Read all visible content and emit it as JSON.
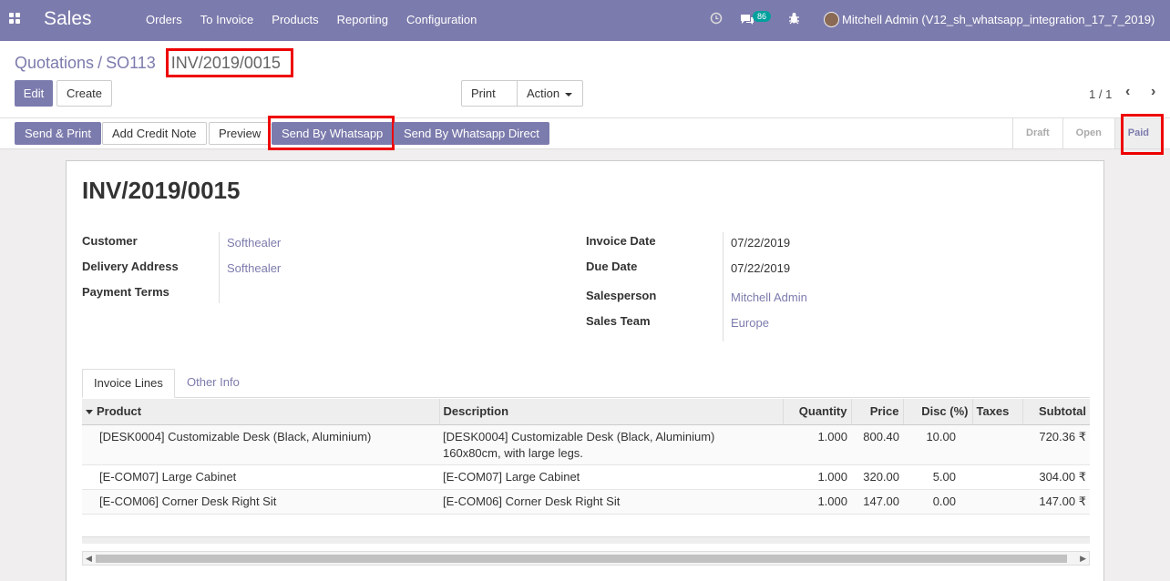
{
  "topbar": {
    "brand": "Sales",
    "menu": [
      "Orders",
      "To Invoice",
      "Products",
      "Reporting",
      "Configuration"
    ],
    "clock_icon": "clock-icon",
    "chat_icon": "chat-icon",
    "chat_count": "86",
    "bug_icon": "bug-icon",
    "user": "Mitchell Admin (V12_sh_whatsapp_integration_17_7_2019)"
  },
  "breadcrumb": {
    "first": "Quotations",
    "sep": "/",
    "second": "SO113",
    "current": "INV/2019/0015"
  },
  "buttons": {
    "edit": "Edit",
    "create": "Create",
    "print": "Print",
    "action": "Action"
  },
  "pager": {
    "value": "1 / 1",
    "prev": "‹",
    "next": "›"
  },
  "statusbar": {
    "send_print": "Send & Print",
    "add_credit_note": "Add Credit Note",
    "preview": "Preview",
    "send_whatsapp": "Send By Whatsapp",
    "send_whatsapp_direct": "Send By Whatsapp Direct",
    "stages": [
      "Draft",
      "Open",
      "Paid"
    ],
    "active_stage": "Paid"
  },
  "invoice": {
    "title": "INV/2019/0015",
    "customer_label": "Customer",
    "customer": "Softhealer",
    "delivery_label": "Delivery Address",
    "delivery": "Softhealer",
    "terms_label": "Payment Terms",
    "invoice_date_label": "Invoice Date",
    "invoice_date": "07/22/2019",
    "due_date_label": "Due Date",
    "due_date": "07/22/2019",
    "salesperson_label": "Salesperson",
    "salesperson": "Mitchell Admin",
    "team_label": "Sales Team",
    "team": "Europe"
  },
  "tabs": [
    "Invoice Lines",
    "Other Info"
  ],
  "lines": {
    "headers": [
      "Product",
      "Description",
      "Quantity",
      "Price",
      "Disc (%)",
      "Taxes",
      "Subtotal"
    ],
    "rows": [
      {
        "product": "[DESK0004] Customizable Desk (Black, Aluminium)",
        "description": "[DESK0004] Customizable Desk (Black, Aluminium)",
        "description2": "160x80cm, with large legs.",
        "qty": "1.000",
        "price": "800.40",
        "disc": "10.00",
        "taxes": "",
        "subtotal": "720.36 ₹"
      },
      {
        "product": "[E-COM07] Large Cabinet",
        "description": "[E-COM07] Large Cabinet",
        "description2": "",
        "qty": "1.000",
        "price": "320.00",
        "disc": "5.00",
        "taxes": "",
        "subtotal": "304.00 ₹"
      },
      {
        "product": "[E-COM06] Corner Desk Right Sit",
        "description": "[E-COM06] Corner Desk Right Sit",
        "description2": "",
        "qty": "1.000",
        "price": "147.00",
        "disc": "0.00",
        "taxes": "",
        "subtotal": "147.00 ₹"
      }
    ]
  },
  "colors": {
    "brand": "#7c7bad",
    "highlight": "#e00000"
  }
}
